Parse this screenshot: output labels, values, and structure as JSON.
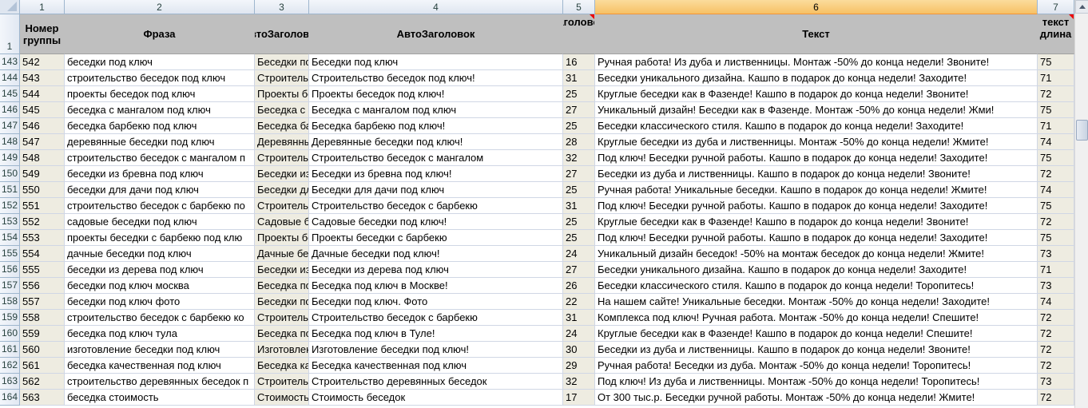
{
  "column_headers": [
    "1",
    "2",
    "3",
    "4",
    "5",
    "6",
    "7"
  ],
  "header_row_number": "1",
  "headers": [
    "Номер группы",
    "Фраза",
    "АвтоЗаголовок",
    "АвтоЗаголовок",
    "заголовок",
    "Текст",
    "текст длина"
  ],
  "rows": [
    {
      "row": "143",
      "group": "542",
      "phrase": "беседки под ключ",
      "auto_short": "Беседки под ключ",
      "auto": "Беседки под ключ",
      "len": "16",
      "text": "Ручная работа! Из дуба и лиственницы. Монтаж -50% до конца недели! Звоните!",
      "text_len": "75"
    },
    {
      "row": "144",
      "group": "543",
      "phrase": "строительство беседок под ключ",
      "auto_short": "Строительство беседок под ключ!",
      "auto": "Строительство беседок под ключ!",
      "len": "31",
      "text": "Беседки уникального дизайна. Кашпо в подарок до конца недели! Заходите!",
      "text_len": "71"
    },
    {
      "row": "145",
      "group": "544",
      "phrase": "проекты беседок под ключ",
      "auto_short": "Проекты беседок под ключ!",
      "auto": "Проекты беседок под ключ!",
      "len": "25",
      "text": "Круглые беседки как в Фазенде! Кашпо в подарок до конца недели! Звоните!",
      "text_len": "72"
    },
    {
      "row": "146",
      "group": "545",
      "phrase": "беседка с мангалом под ключ",
      "auto_short": "Беседка с мангалом под ключ",
      "auto": "Беседка с мангалом под ключ",
      "len": "27",
      "text": "Уникальный дизайн! Беседки как в Фазенде. Монтаж -50% до конца недели! Жми!",
      "text_len": "75"
    },
    {
      "row": "147",
      "group": "546",
      "phrase": "беседка барбекю под ключ",
      "auto_short": "Беседка барбекю под ключ!",
      "auto": "Беседка барбекю под ключ!",
      "len": "25",
      "text": "Беседки классического стиля. Кашпо в подарок до конца недели! Заходите!",
      "text_len": "71"
    },
    {
      "row": "148",
      "group": "547",
      "phrase": "деревянные беседки под ключ",
      "auto_short": "Деревянные беседки под ключ!",
      "auto": "Деревянные беседки под ключ!",
      "len": "28",
      "text": "Круглые беседки из дуба и лиственницы. Монтаж -50% до конца недели! Жмите!",
      "text_len": "74"
    },
    {
      "row": "149",
      "group": "548",
      "phrase": "строительство беседок с мангалом п",
      "auto_short": "Строительство беседок с мангалом",
      "auto": "Строительство беседок с мангалом",
      "len": "32",
      "text": "Под ключ! Беседки ручной работы. Кашпо в подарок до конца недели! Заходите!",
      "text_len": "75"
    },
    {
      "row": "150",
      "group": "549",
      "phrase": "беседки из бревна под ключ",
      "auto_short": "Беседки из бревна под ключ!",
      "auto": "Беседки из бревна под ключ!",
      "len": "27",
      "text": "Беседки из дуба и лиственницы. Кашпо в подарок до конца недели! Звоните!",
      "text_len": "72"
    },
    {
      "row": "151",
      "group": "550",
      "phrase": "беседки для дачи под ключ",
      "auto_short": "Беседки для дачи под ключ",
      "auto": "Беседки для дачи под ключ",
      "len": "25",
      "text": "Ручная работа! Уникальные беседки. Кашпо в подарок до конца недели! Жмите!",
      "text_len": "74"
    },
    {
      "row": "152",
      "group": "551",
      "phrase": "строительство беседок с барбекю по",
      "auto_short": "Строительство беседок с барбекю",
      "auto": "Строительство беседок с барбекю",
      "len": "31",
      "text": "Под ключ! Беседки ручной работы. Кашпо в подарок до конца недели! Заходите!",
      "text_len": "75"
    },
    {
      "row": "153",
      "group": "552",
      "phrase": "садовые беседки под ключ",
      "auto_short": "Садовые беседки под ключ!",
      "auto": "Садовые беседки под ключ!",
      "len": "25",
      "text": "Круглые беседки как в Фазенде! Кашпо в подарок до конца недели! Звоните!",
      "text_len": "72"
    },
    {
      "row": "154",
      "group": "553",
      "phrase": "проекты беседки с барбекю под клю",
      "auto_short": "Проекты беседки с барбекю",
      "auto": "Проекты беседки с барбекю",
      "len": "25",
      "text": "Под ключ! Беседки ручной работы. Кашпо в подарок до конца недели! Заходите!",
      "text_len": "75"
    },
    {
      "row": "155",
      "group": "554",
      "phrase": "дачные беседки под ключ",
      "auto_short": "Дачные беседки под ключ!",
      "auto": "Дачные беседки под ключ!",
      "len": "24",
      "text": "Уникальный дизайн беседок! -50% на монтаж беседок до конца недели! Жмите!",
      "text_len": "73"
    },
    {
      "row": "156",
      "group": "555",
      "phrase": "беседки из дерева под ключ",
      "auto_short": "Беседки из дерева под ключ",
      "auto": "Беседки из дерева под ключ",
      "len": "27",
      "text": "Беседки уникального дизайна. Кашпо в подарок до конца недели! Заходите!",
      "text_len": "71"
    },
    {
      "row": "157",
      "group": "556",
      "phrase": "беседки под ключ москва",
      "auto_short": "Беседка под ключ в Москве!",
      "auto": "Беседка под ключ в Москве!",
      "len": "26",
      "text": "Беседки классического стиля. Кашпо в подарок до конца недели! Торопитесь!",
      "text_len": "73"
    },
    {
      "row": "158",
      "group": "557",
      "phrase": "беседки под ключ фото",
      "auto_short": "Беседки под ключ. Фото",
      "auto": "Беседки под ключ. Фото",
      "len": "22",
      "text": "На нашем сайте! Уникальные беседки. Монтаж -50% до конца недели! Заходите!",
      "text_len": "74"
    },
    {
      "row": "159",
      "group": "558",
      "phrase": "строительство беседок с барбекю ко",
      "auto_short": "Строительство беседок с барбекю",
      "auto": "Строительство беседок с барбекю",
      "len": "31",
      "text": "Комплекса под ключ! Ручная работа. Монтаж -50% до конца недели! Спешите!",
      "text_len": "72"
    },
    {
      "row": "160",
      "group": "559",
      "phrase": "беседка под ключ тула",
      "auto_short": "Беседка под ключ в Туле!",
      "auto": "Беседка под ключ в Туле!",
      "len": "24",
      "text": "Круглые беседки как в Фазенде! Кашпо в подарок до конца недели! Спешите!",
      "text_len": "72"
    },
    {
      "row": "161",
      "group": "560",
      "phrase": "изготовление беседки под ключ",
      "auto_short": "Изготовление беседки под ключ!",
      "auto": "Изготовление беседки под ключ!",
      "len": "30",
      "text": "Беседки из дуба и лиственницы. Кашпо в подарок до конца недели! Звоните!",
      "text_len": "72"
    },
    {
      "row": "162",
      "group": "561",
      "phrase": "беседка качественная под ключ",
      "auto_short": "Беседка качественная под ключ",
      "auto": "Беседка качественная под ключ",
      "len": "29",
      "text": "Ручная работа! Беседки из дуба. Монтаж -50% до конца недели! Торопитесь!",
      "text_len": "72"
    },
    {
      "row": "163",
      "group": "562",
      "phrase": "строительство деревянных беседок п",
      "auto_short": "Строительство деревянных беседок",
      "auto": "Строительство деревянных беседок",
      "len": "32",
      "text": "Под ключ! Из дуба и лиственницы. Монтаж -50% до конца недели! Торопитесь!",
      "text_len": "73"
    },
    {
      "row": "164",
      "group": "563",
      "phrase": "беседка стоимость",
      "auto_short": "Стоимость беседок",
      "auto": "Стоимость беседок",
      "len": "17",
      "text": "От 300 тыс.р. Беседки ручной работы. Монтаж -50% до конца недели! Жмите!",
      "text_len": "72"
    }
  ]
}
